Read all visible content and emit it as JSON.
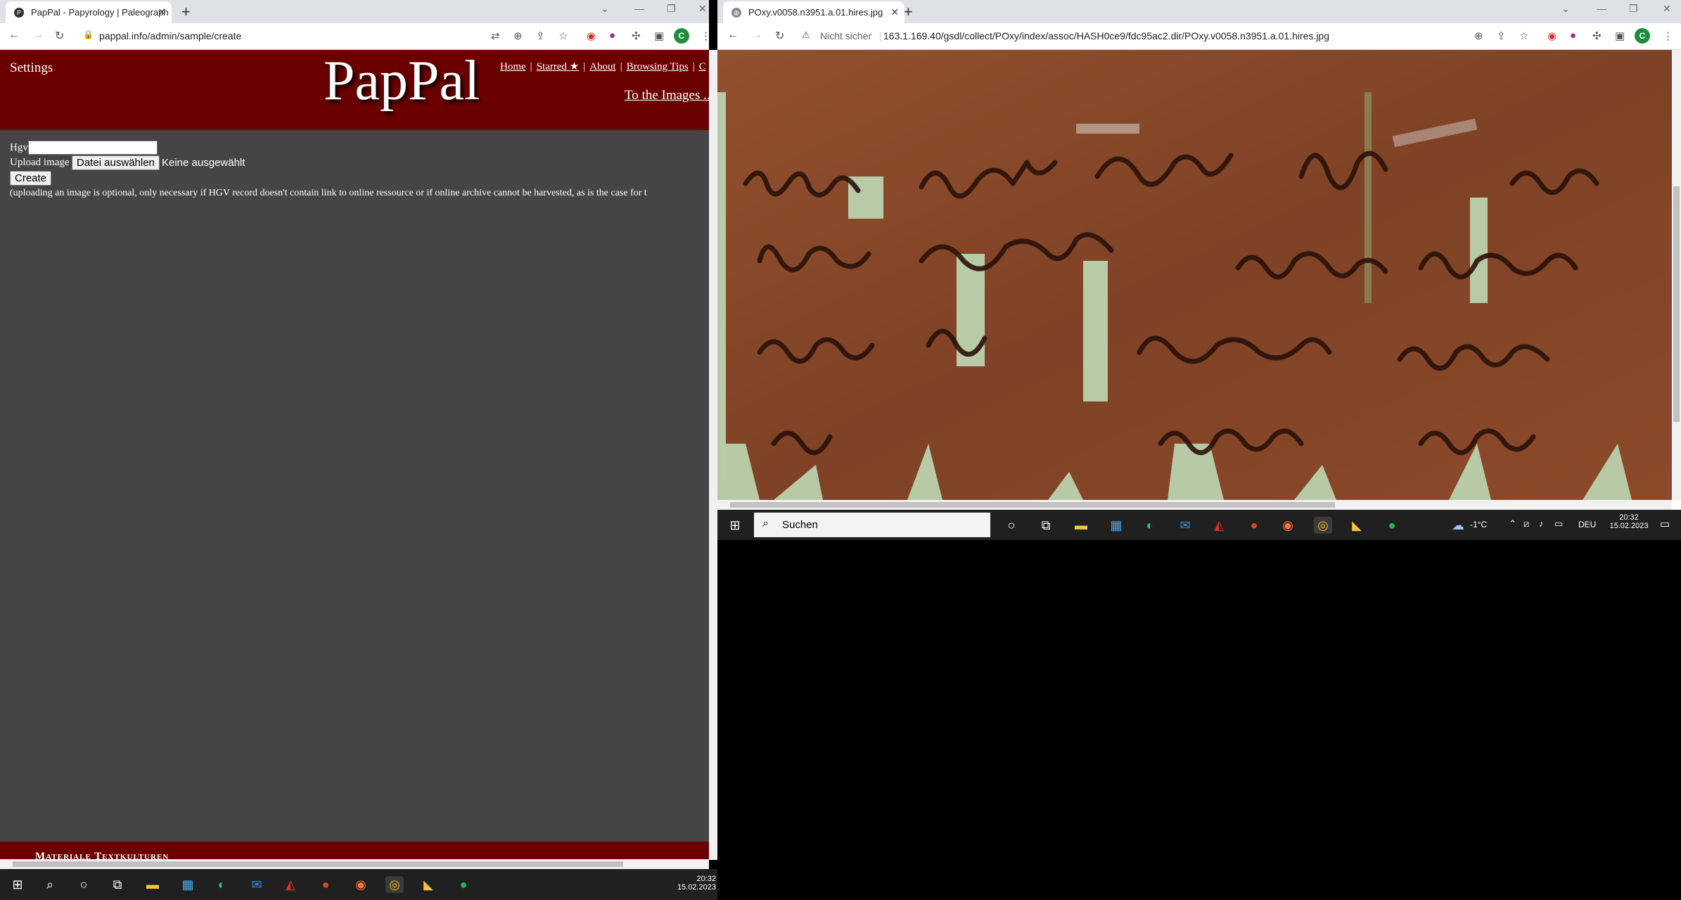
{
  "left_window": {
    "tab_title": "PapPal - Papyrology | Paleograph",
    "tab_favicon": "P",
    "url": "pappal.info/admin/sample/create",
    "profile_initial": "C"
  },
  "pappal": {
    "settings_label": "Settings",
    "logo": "PapPal",
    "nav": [
      "Home",
      "Starred ★",
      "About",
      "Browsing Tips",
      "C"
    ],
    "images_link": "To the Images ...",
    "hgv_label": "Hgv",
    "hgv_value": "",
    "upload_label": "Upload image",
    "choose_file_button": "Datei auswählen",
    "no_file_text": "Keine ausgewählt",
    "create_button": "Create",
    "note": "(uploading an image is optional, only necessary if HGV record doesn't contain link to online ressource or if online archive cannot be harvested, as is the case for t",
    "footer_text": "Materiale Textkulturen"
  },
  "right_window": {
    "tab_title": "POxy.v0058.n3951.a.01.hires.jpg",
    "security_label": "Nicht sicher",
    "url": "163.1.169.40/gsdl/collect/POxy/index/assoc/HASH0ce9/fdc95ac2.dir/POxy.v0058.n3951.a.01.hires.jpg",
    "profile_initial": "C"
  },
  "taskbar_left": {
    "time": "20:32",
    "date": "15.02.2023"
  },
  "taskbar_right": {
    "search_placeholder": "Suchen",
    "weather": "-1°C",
    "language": "DEU",
    "time": "20:32",
    "date": "15.02.2023"
  },
  "colors": {
    "pappal_header": "#6b0000",
    "page_bg": "#454545",
    "papyrus": "#8b4a2b"
  }
}
